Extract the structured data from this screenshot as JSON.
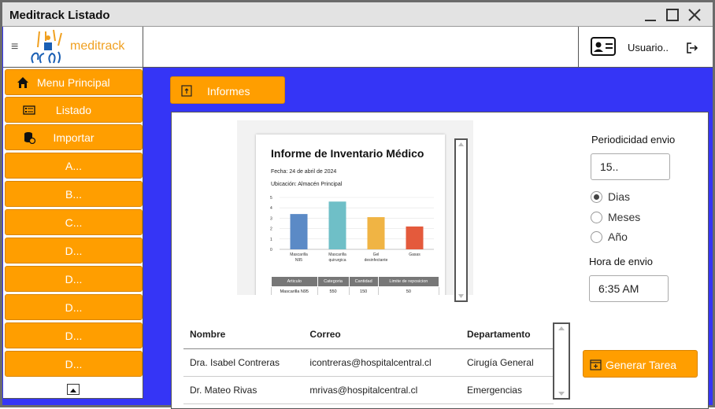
{
  "window": {
    "title": "Meditrack Listado"
  },
  "brand": {
    "name": "meditrack"
  },
  "user": {
    "label": "Usuario.."
  },
  "sidebar": {
    "main_items": [
      {
        "label": "Menu Principal",
        "icon": "home-icon"
      },
      {
        "label": "Listado",
        "icon": "list-icon"
      },
      {
        "label": "Importar",
        "icon": "database-import-icon"
      }
    ],
    "sub_items": [
      "A...",
      "B...",
      "C...",
      "D...",
      "D...",
      "D...",
      "D...",
      "D..."
    ]
  },
  "informes_button": {
    "label": "Informes",
    "icon": "report-icon"
  },
  "report_preview": {
    "title": "Informe de Inventario Médico",
    "fecha": "Fecha: 24 de abril de 2024",
    "ubicacion": "Ubicación: Almacén Principal",
    "chart_data": {
      "type": "bar",
      "categories": [
        "Mascarilla N95",
        "Mascarilla quirurgica",
        "Gel desinfectante",
        "Gasas"
      ],
      "values": [
        3.4,
        4.6,
        3.1,
        2.2
      ],
      "ylim": [
        0,
        5
      ],
      "yticks": [
        "0",
        "1",
        "2",
        "3",
        "4",
        "5"
      ],
      "colors": [
        "#5b8ac6",
        "#6fbfc7",
        "#f0b444",
        "#e45a3c"
      ]
    },
    "table": {
      "headers": [
        "Articulo",
        "Categoria",
        "Cantidad",
        "Limite de reposicion"
      ],
      "rows": [
        [
          "Mascarilla N95",
          "550",
          "150",
          "50"
        ]
      ]
    }
  },
  "settings": {
    "periodicidad_label": "Periodicidad envio",
    "periodicidad_value": "15..",
    "radio_options": [
      {
        "label": "Dias",
        "selected": true
      },
      {
        "label": "Meses",
        "selected": false
      },
      {
        "label": "Año",
        "selected": false
      }
    ],
    "hora_label": "Hora de envio",
    "hora_value": "6:35 AM"
  },
  "contacts_table": {
    "headers": [
      "Nombre",
      "Correo",
      "Departamento"
    ],
    "rows": [
      [
        "Dra. Isabel Contreras",
        "icontreras@hospitalcentral.cl",
        "Cirugía General"
      ],
      [
        "Dr. Mateo Rivas",
        "mrivas@hospitalcentral.cl",
        "Emergencias"
      ]
    ]
  },
  "generar_button": {
    "label": "Generar Tarea",
    "icon": "calendar-plus-icon"
  },
  "colors": {
    "accent": "#ff9e00",
    "background": "#3535f6",
    "brand_text": "#f0a020"
  }
}
